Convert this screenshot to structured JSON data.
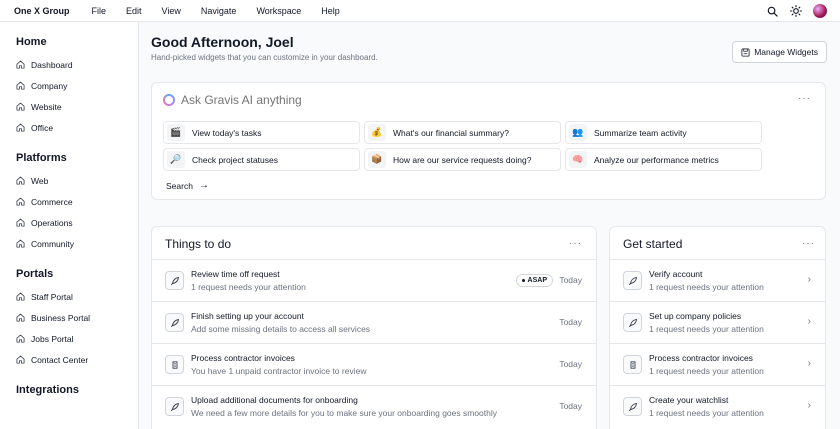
{
  "menubar": {
    "brand": "One X Group",
    "items": [
      "File",
      "Edit",
      "View",
      "Navigate",
      "Workspace",
      "Help"
    ],
    "right_icons": [
      "search-icon",
      "sun-icon",
      "avatar"
    ]
  },
  "sidebar": {
    "sections": [
      {
        "heading": "Home",
        "items": [
          "Dashboard",
          "Company",
          "Website",
          "Office"
        ]
      },
      {
        "heading": "Platforms",
        "items": [
          "Web",
          "Commerce",
          "Operations",
          "Community"
        ]
      },
      {
        "heading": "Portals",
        "items": [
          "Staff Portal",
          "Business Portal",
          "Jobs Portal",
          "Contact Center"
        ]
      },
      {
        "heading": "Integrations",
        "items": []
      }
    ]
  },
  "header": {
    "greeting": "Good Afternoon, Joel",
    "subtitle": "Hand-picked widgets that you can customize in your dashboard.",
    "manage_label": "Manage Widgets"
  },
  "ai": {
    "placeholder": "Ask Gravis AI anything",
    "more": "···",
    "suggestions": [
      {
        "icon": "🎬",
        "label": "View today's tasks"
      },
      {
        "icon": "💰",
        "label": "What's our financial summary?"
      },
      {
        "icon": "👥",
        "label": "Summarize team activity"
      },
      {
        "icon": "🔎",
        "label": "Check project statuses"
      },
      {
        "icon": "📦",
        "label": "How are our service requests doing?"
      },
      {
        "icon": "🧠",
        "label": "Analyze our performance metrics"
      }
    ],
    "search_label": "Search",
    "search_arrow": "→"
  },
  "todo": {
    "title": "Things to do",
    "more": "···",
    "rows": [
      {
        "title": "Review time off request",
        "subtitle": "1 request needs your attention",
        "badge": "ASAP",
        "date": "Today",
        "icon": "rocket-icon"
      },
      {
        "title": "Finish setting up your account",
        "subtitle": "Add some missing details to access all services",
        "date": "Today",
        "icon": "rocket-icon"
      },
      {
        "title": "Process contractor invoices",
        "subtitle": "You have 1 unpaid contractor invoice to review",
        "date": "Today",
        "icon": "document-icon"
      },
      {
        "title": "Upload additional documents for onboarding",
        "subtitle": "We need a few more details for you to make sure your onboarding goes smoothly",
        "date": "Today",
        "icon": "rocket-icon"
      }
    ]
  },
  "get_started": {
    "title": "Get started",
    "more": "···",
    "rows": [
      {
        "title": "Verify account",
        "subtitle": "1 request needs your attention",
        "icon": "rocket-icon"
      },
      {
        "title": "Set up company policies",
        "subtitle": "1 request needs your attention",
        "icon": "rocket-icon"
      },
      {
        "title": "Process contractor invoices",
        "subtitle": "1 request needs your attention",
        "icon": "document-icon"
      },
      {
        "title": "Create your watchlist",
        "subtitle": "1 request needs your attention",
        "icon": "rocket-icon"
      }
    ],
    "chevron": "›"
  }
}
